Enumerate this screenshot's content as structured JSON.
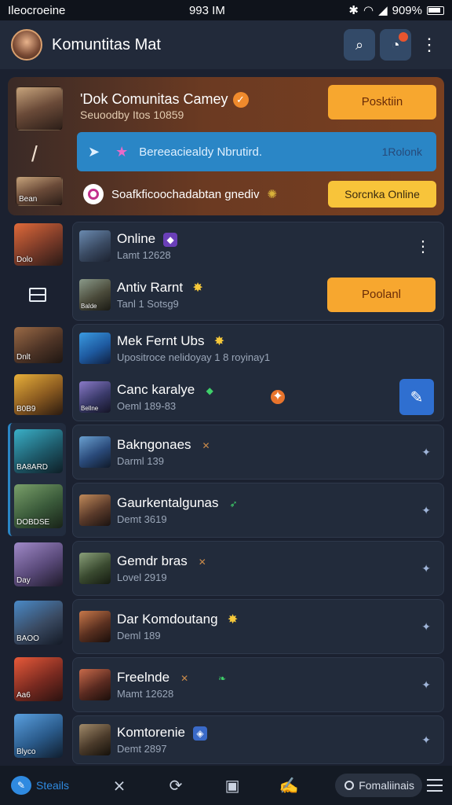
{
  "status": {
    "carrier": "Ileocroeine",
    "time": "993 IM",
    "battery": "909%"
  },
  "header": {
    "title": "Komuntitas Mat"
  },
  "banner": {
    "title": "'Dok Comunitas Camey",
    "subtitle": "Seuoodby Itos 10859",
    "primary_button": "Posktiin",
    "blue_bar_text": "Bereeaciealdy Nbrutird.",
    "blue_bar_right": "1Rolonk",
    "row3_text": "Soafkficoochadabtan gnediv",
    "secondary_button": "Sorcnka Online",
    "thumb_label": "Bean"
  },
  "sidebar": {
    "thumbs": [
      {
        "label": "Dolo"
      },
      {
        "label": "Dnlt"
      },
      {
        "label": "B0B9"
      },
      {
        "label": "BA8ARD"
      },
      {
        "label": "DOBDSE"
      },
      {
        "label": "Day"
      },
      {
        "label": "BAOO"
      },
      {
        "label": "Aa6"
      },
      {
        "label": "Blyco"
      }
    ]
  },
  "group1": [
    {
      "name": "Online",
      "sub": "Lamt 12628",
      "badge": "badge"
    },
    {
      "name": "Antiv Rarnt",
      "sub": "Tanl 1 Sotsg9",
      "button": "Poolanl",
      "thumb_label": "Balde"
    }
  ],
  "group2": [
    {
      "name": "Mek Fernt Ubs",
      "sub": "Upositroce nelidoyay 1 8 royinay1"
    },
    {
      "name": "Canc karalye",
      "sub": "Oeml 189-83",
      "thumb_label": "Bellne"
    }
  ],
  "list": [
    {
      "name": "Bakngonaes",
      "sub": "Darml 139"
    },
    {
      "name": "Gaurkentalgunas",
      "sub": "Demt 3619"
    },
    {
      "name": "Gemdr bras",
      "sub": "Lovel 2919"
    },
    {
      "name": "Dar Komdoutang",
      "sub": "Deml 189"
    },
    {
      "name": "Freelnde",
      "sub": "Mamt 12628"
    },
    {
      "name": "Komtorenie",
      "sub": "Demt 2897"
    }
  ],
  "bottom_nav": {
    "active_label": "Steails",
    "pill_label": "Fomaliinais"
  },
  "icons": [
    "search-icon",
    "notification-icon",
    "more-icon",
    "menu-icon",
    "chat-icon",
    "close-icon",
    "refresh-icon",
    "gallery-icon",
    "compose-icon",
    "list-icon"
  ],
  "colors": {
    "accent": "#2a86c6",
    "orange": "#f7a72f",
    "bg": "#1b2130"
  }
}
